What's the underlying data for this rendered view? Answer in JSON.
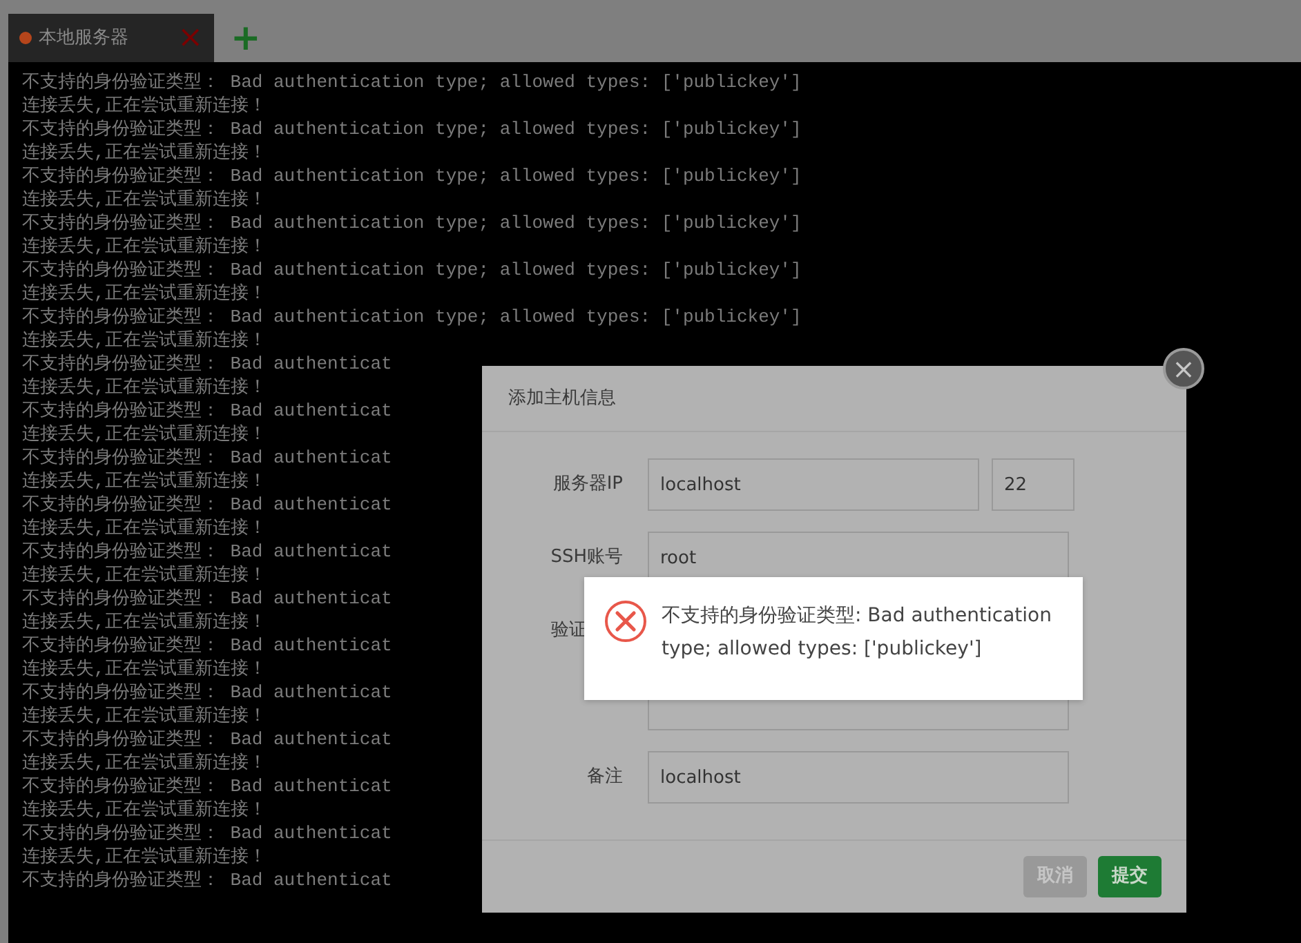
{
  "tabs": [
    {
      "label": "本地服务器",
      "selected": true,
      "color": "#b5451b",
      "close": "×"
    }
  ],
  "add_tab": "+",
  "terminal": {
    "lines": [
      "不支持的身份验证类型： Bad authentication type; allowed types: ['publickey']",
      "连接丢失,正在尝试重新连接！",
      "不支持的身份验证类型： Bad authentication type; allowed types: ['publickey']",
      "连接丢失,正在尝试重新连接！",
      "不支持的身份验证类型： Bad authentication type; allowed types: ['publickey']",
      "连接丢失,正在尝试重新连接！",
      "不支持的身份验证类型： Bad authentication type; allowed types: ['publickey']",
      "连接丢失,正在尝试重新连接！",
      "不支持的身份验证类型： Bad authentication type; allowed types: ['publickey']",
      "连接丢失,正在尝试重新连接！",
      "不支持的身份验证类型： Bad authentication type; allowed types: ['publickey']",
      "连接丢失,正在尝试重新连接！",
      "不支持的身份验证类型： Bad authenticat",
      "连接丢失,正在尝试重新连接！",
      "不支持的身份验证类型： Bad authenticat",
      "连接丢失,正在尝试重新连接！",
      "不支持的身份验证类型： Bad authenticat",
      "连接丢失,正在尝试重新连接！",
      "不支持的身份验证类型： Bad authenticat",
      "连接丢失,正在尝试重新连接！",
      "不支持的身份验证类型： Bad authenticat",
      "连接丢失,正在尝试重新连接！",
      "不支持的身份验证类型： Bad authenticat",
      "连接丢失,正在尝试重新连接！",
      "不支持的身份验证类型： Bad authenticat",
      "连接丢失,正在尝试重新连接！",
      "不支持的身份验证类型： Bad authenticat",
      "连接丢失,正在尝试重新连接！",
      "不支持的身份验证类型： Bad authenticat",
      "连接丢失,正在尝试重新连接！",
      "不支持的身份验证类型： Bad authenticat",
      "连接丢失,正在尝试重新连接！",
      "不支持的身份验证类型： Bad authenticat",
      "连接丢失,正在尝试重新连接！",
      "不支持的身份验证类型： Bad authenticat"
    ]
  },
  "dialog": {
    "title": "添加主机信息",
    "close": "×",
    "fields": [
      {
        "label": "服务器IP",
        "value": "localhost",
        "port": "22"
      },
      {
        "label": "SSH账号",
        "value": "root"
      },
      {
        "label": "验证",
        "label_cut": true
      },
      {
        "input": true
      },
      {
        "label": "备注",
        "value": "localhost"
      }
    ],
    "buttons": [
      {
        "label": "取消",
        "kind": "cancel"
      },
      {
        "label": "提交",
        "kind": "submit"
      }
    ]
  },
  "toast": {
    "kind": "error",
    "message": "不支持的身份验证类型: Bad authentication type; allowed types: ['publickey']"
  }
}
